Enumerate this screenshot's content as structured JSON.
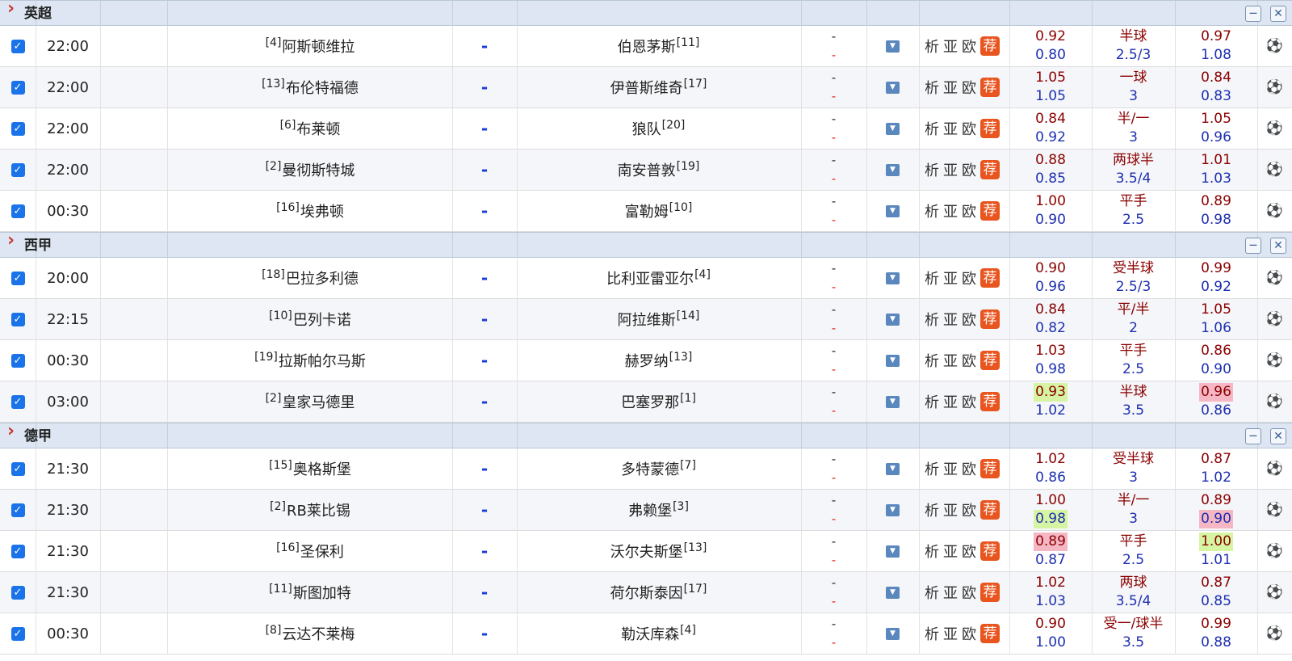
{
  "leagues": [
    {
      "name": "英超",
      "matches": [
        {
          "time": "22:00",
          "home_rank": "[4]",
          "home": "阿斯顿维拉",
          "away": "伯恩茅斯",
          "away_rank": "[11]",
          "vs": "-",
          "score_top": "-",
          "score_bot": "-",
          "analysis": "析",
          "asia": "亚",
          "euro": "欧",
          "recommend": "荐",
          "odds_home_up": "0.92",
          "odds_home_dn": "0.80",
          "handicap_top": "半球",
          "handicap_bot": "2.5/3",
          "odds_away_up": "0.97",
          "odds_away_dn": "1.08",
          "highlights": {}
        },
        {
          "time": "22:00",
          "home_rank": "[13]",
          "home": "布伦特福德",
          "away": "伊普斯维奇",
          "away_rank": "[17]",
          "vs": "-",
          "score_top": "-",
          "score_bot": "-",
          "analysis": "析",
          "asia": "亚",
          "euro": "欧",
          "recommend": "荐",
          "odds_home_up": "1.05",
          "odds_home_dn": "1.05",
          "handicap_top": "一球",
          "handicap_bot": "3",
          "odds_away_up": "0.84",
          "odds_away_dn": "0.83",
          "highlights": {}
        },
        {
          "time": "22:00",
          "home_rank": "[6]",
          "home": "布莱顿",
          "away": "狼队",
          "away_rank": "[20]",
          "vs": "-",
          "score_top": "-",
          "score_bot": "-",
          "analysis": "析",
          "asia": "亚",
          "euro": "欧",
          "recommend": "荐",
          "odds_home_up": "0.84",
          "odds_home_dn": "0.92",
          "handicap_top": "半/一",
          "handicap_bot": "3",
          "odds_away_up": "1.05",
          "odds_away_dn": "0.96",
          "highlights": {}
        },
        {
          "time": "22:00",
          "home_rank": "[2]",
          "home": "曼彻斯特城",
          "away": "南安普敦",
          "away_rank": "[19]",
          "vs": "-",
          "score_top": "-",
          "score_bot": "-",
          "analysis": "析",
          "asia": "亚",
          "euro": "欧",
          "recommend": "荐",
          "odds_home_up": "0.88",
          "odds_home_dn": "0.85",
          "handicap_top": "两球半",
          "handicap_bot": "3.5/4",
          "odds_away_up": "1.01",
          "odds_away_dn": "1.03",
          "highlights": {}
        },
        {
          "time": "00:30",
          "home_rank": "[16]",
          "home": "埃弗顿",
          "away": "富勒姆",
          "away_rank": "[10]",
          "vs": "-",
          "score_top": "-",
          "score_bot": "-",
          "analysis": "析",
          "asia": "亚",
          "euro": "欧",
          "recommend": "荐",
          "odds_home_up": "1.00",
          "odds_home_dn": "0.90",
          "handicap_top": "平手",
          "handicap_bot": "2.5",
          "odds_away_up": "0.89",
          "odds_away_dn": "0.98",
          "highlights": {}
        }
      ]
    },
    {
      "name": "西甲",
      "matches": [
        {
          "time": "20:00",
          "home_rank": "[18]",
          "home": "巴拉多利德",
          "away": "比利亚雷亚尔",
          "away_rank": "[4]",
          "vs": "-",
          "score_top": "-",
          "score_bot": "-",
          "analysis": "析",
          "asia": "亚",
          "euro": "欧",
          "recommend": "荐",
          "odds_home_up": "0.90",
          "odds_home_dn": "0.96",
          "handicap_top": "受半球",
          "handicap_bot": "2.5/3",
          "odds_away_up": "0.99",
          "odds_away_dn": "0.92",
          "highlights": {}
        },
        {
          "time": "22:15",
          "home_rank": "[10]",
          "home": "巴列卡诺",
          "away": "阿拉维斯",
          "away_rank": "[14]",
          "vs": "-",
          "score_top": "-",
          "score_bot": "-",
          "analysis": "析",
          "asia": "亚",
          "euro": "欧",
          "recommend": "荐",
          "odds_home_up": "0.84",
          "odds_home_dn": "0.82",
          "handicap_top": "平/半",
          "handicap_bot": "2",
          "odds_away_up": "1.05",
          "odds_away_dn": "1.06",
          "highlights": {}
        },
        {
          "time": "00:30",
          "home_rank": "[19]",
          "home": "拉斯帕尔马斯",
          "away": "赫罗纳",
          "away_rank": "[13]",
          "vs": "-",
          "score_top": "-",
          "score_bot": "-",
          "analysis": "析",
          "asia": "亚",
          "euro": "欧",
          "recommend": "荐",
          "odds_home_up": "1.03",
          "odds_home_dn": "0.98",
          "handicap_top": "平手",
          "handicap_bot": "2.5",
          "odds_away_up": "0.86",
          "odds_away_dn": "0.90",
          "highlights": {}
        },
        {
          "time": "03:00",
          "home_rank": "[2]",
          "home": "皇家马德里",
          "away": "巴塞罗那",
          "away_rank": "[1]",
          "vs": "-",
          "score_top": "-",
          "score_bot": "-",
          "analysis": "析",
          "asia": "亚",
          "euro": "欧",
          "recommend": "荐",
          "odds_home_up": "0.93",
          "odds_home_dn": "1.02",
          "handicap_top": "半球",
          "handicap_bot": "3.5",
          "odds_away_up": "0.96",
          "odds_away_dn": "0.86",
          "highlights": {
            "odds_home_up": "green",
            "odds_away_up": "pink"
          }
        }
      ]
    },
    {
      "name": "德甲",
      "matches": [
        {
          "time": "21:30",
          "home_rank": "[15]",
          "home": "奥格斯堡",
          "away": "多特蒙德",
          "away_rank": "[7]",
          "vs": "-",
          "score_top": "-",
          "score_bot": "-",
          "analysis": "析",
          "asia": "亚",
          "euro": "欧",
          "recommend": "荐",
          "odds_home_up": "1.02",
          "odds_home_dn": "0.86",
          "handicap_top": "受半球",
          "handicap_bot": "3",
          "odds_away_up": "0.87",
          "odds_away_dn": "1.02",
          "highlights": {}
        },
        {
          "time": "21:30",
          "home_rank": "[2]",
          "home": "RB莱比锡",
          "away": "弗赖堡",
          "away_rank": "[3]",
          "vs": "-",
          "score_top": "-",
          "score_bot": "-",
          "analysis": "析",
          "asia": "亚",
          "euro": "欧",
          "recommend": "荐",
          "odds_home_up": "1.00",
          "odds_home_dn": "0.98",
          "handicap_top": "半/一",
          "handicap_bot": "3",
          "odds_away_up": "0.89",
          "odds_away_dn": "0.90",
          "highlights": {
            "odds_home_dn": "green",
            "odds_away_dn": "pink"
          }
        },
        {
          "time": "21:30",
          "home_rank": "[16]",
          "home": "圣保利",
          "away": "沃尔夫斯堡",
          "away_rank": "[13]",
          "vs": "-",
          "score_top": "-",
          "score_bot": "-",
          "analysis": "析",
          "asia": "亚",
          "euro": "欧",
          "recommend": "荐",
          "odds_home_up": "0.89",
          "odds_home_dn": "0.87",
          "handicap_top": "平手",
          "handicap_bot": "2.5",
          "odds_away_up": "1.00",
          "odds_away_dn": "1.01",
          "highlights": {
            "odds_home_up": "pink",
            "odds_away_up": "green"
          }
        },
        {
          "time": "21:30",
          "home_rank": "[11]",
          "home": "斯图加特",
          "away": "荷尔斯泰因",
          "away_rank": "[17]",
          "vs": "-",
          "score_top": "-",
          "score_bot": "-",
          "analysis": "析",
          "asia": "亚",
          "euro": "欧",
          "recommend": "荐",
          "odds_home_up": "1.02",
          "odds_home_dn": "1.03",
          "handicap_top": "两球",
          "handicap_bot": "3.5/4",
          "odds_away_up": "0.87",
          "odds_away_dn": "0.85",
          "highlights": {}
        },
        {
          "time": "00:30",
          "home_rank": "[8]",
          "home": "云达不莱梅",
          "away": "勒沃库森",
          "away_rank": "[4]",
          "vs": "-",
          "score_top": "-",
          "score_bot": "-",
          "analysis": "析",
          "asia": "亚",
          "euro": "欧",
          "recommend": "荐",
          "odds_home_up": "0.90",
          "odds_home_dn": "1.00",
          "handicap_top": "受一/球半",
          "handicap_bot": "3.5",
          "odds_away_up": "0.99",
          "odds_away_dn": "0.88",
          "highlights": {}
        }
      ]
    }
  ],
  "icons": {
    "collapse": "chevron-right-icon",
    "checkbox": "checkbox-checked-icon",
    "dropdown": "dropdown-arrow-icon",
    "minimize": "minimize-icon",
    "close": "close-icon",
    "ball": "football-icon"
  },
  "colors": {
    "header_bg": "#dde6f2",
    "odds_up": "#8b0000",
    "odds_down": "#1e2fb0",
    "score_red": "#d22222",
    "recommend_bg": "#e8551f",
    "checkbox": "#1a73e8",
    "highlight_green": "#d6f5a3",
    "highlight_pink": "#f6b7c5"
  }
}
